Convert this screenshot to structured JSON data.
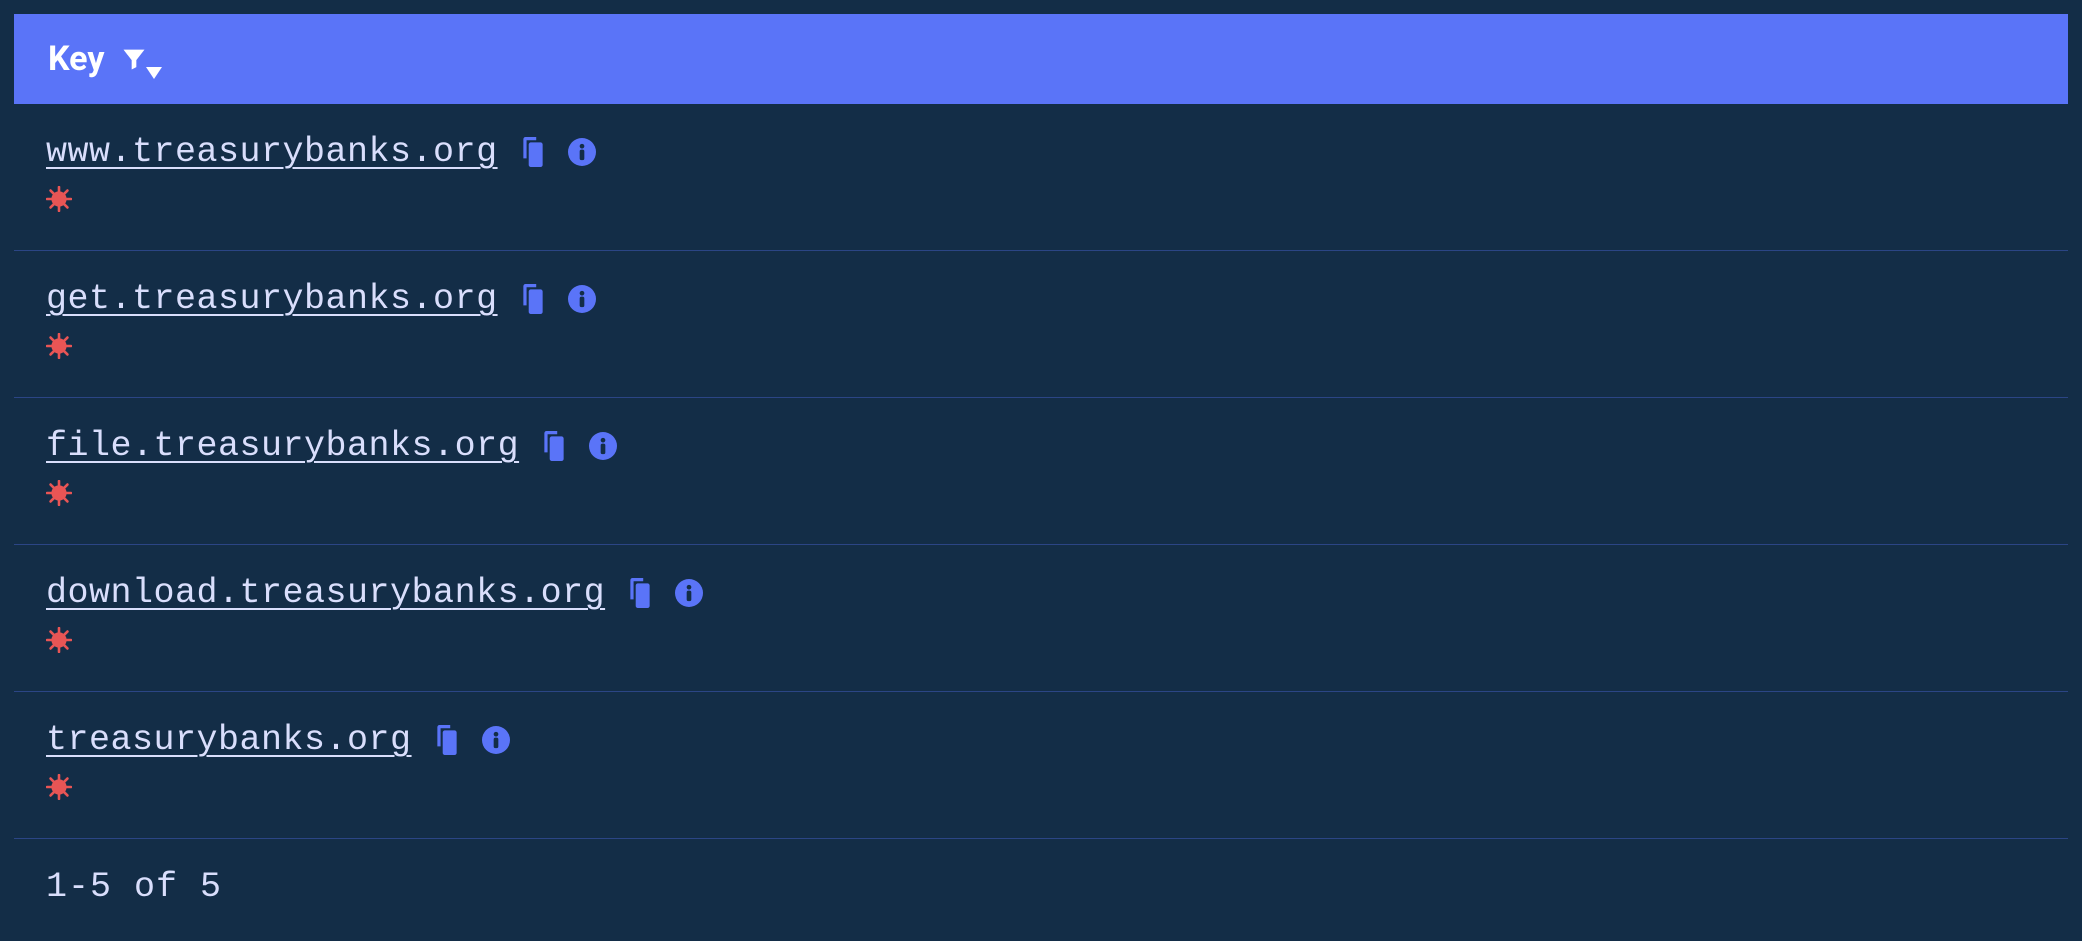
{
  "header": {
    "label": "Key"
  },
  "rows": [
    {
      "domain": "www.treasurybanks.org"
    },
    {
      "domain": "get.treasurybanks.org"
    },
    {
      "domain": "file.treasurybanks.org"
    },
    {
      "domain": "download.treasurybanks.org"
    },
    {
      "domain": "treasurybanks.org"
    }
  ],
  "pagination": {
    "text": "1-5 of 5"
  }
}
